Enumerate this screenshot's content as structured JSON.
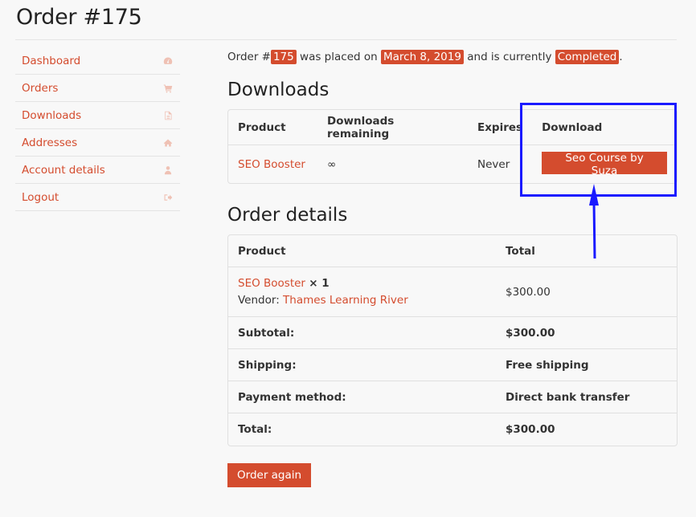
{
  "page": {
    "title": "Order #175"
  },
  "sidebar": {
    "items": [
      {
        "label": "Dashboard",
        "icon": "dashboard-icon"
      },
      {
        "label": "Orders",
        "icon": "cart-icon"
      },
      {
        "label": "Downloads",
        "icon": "file-icon"
      },
      {
        "label": "Addresses",
        "icon": "home-icon"
      },
      {
        "label": "Account details",
        "icon": "user-icon"
      },
      {
        "label": "Logout",
        "icon": "logout-icon"
      }
    ]
  },
  "order_summary": {
    "prefix": "Order #",
    "order_number": "175",
    "placed_text": " was placed on ",
    "date": "March 8, 2019",
    "status_text": " and is currently ",
    "status": "Completed",
    "suffix": "."
  },
  "downloads": {
    "heading": "Downloads",
    "columns": [
      "Product",
      "Downloads remaining",
      "Expires",
      "Download"
    ],
    "rows": [
      {
        "product": "SEO Booster",
        "remaining": "∞",
        "expires": "Never",
        "download_label": "Seo Course by Suza"
      }
    ]
  },
  "order_details": {
    "heading": "Order details",
    "columns": [
      "Product",
      "Total"
    ],
    "item": {
      "product": "SEO Booster",
      "quantity": "× 1",
      "vendor_label": "Vendor: ",
      "vendor": "Thames Learning River",
      "total": "$300.00"
    },
    "totals": [
      {
        "label": "Subtotal:",
        "value": "$300.00"
      },
      {
        "label": "Shipping:",
        "value": "Free shipping"
      },
      {
        "label": "Payment method:",
        "value": "Direct bank transfer"
      },
      {
        "label": "Total:",
        "value": "$300.00"
      }
    ]
  },
  "actions": {
    "order_again": "Order again"
  },
  "colors": {
    "accent": "#d44c2e",
    "annotation": "#1a1aff"
  }
}
